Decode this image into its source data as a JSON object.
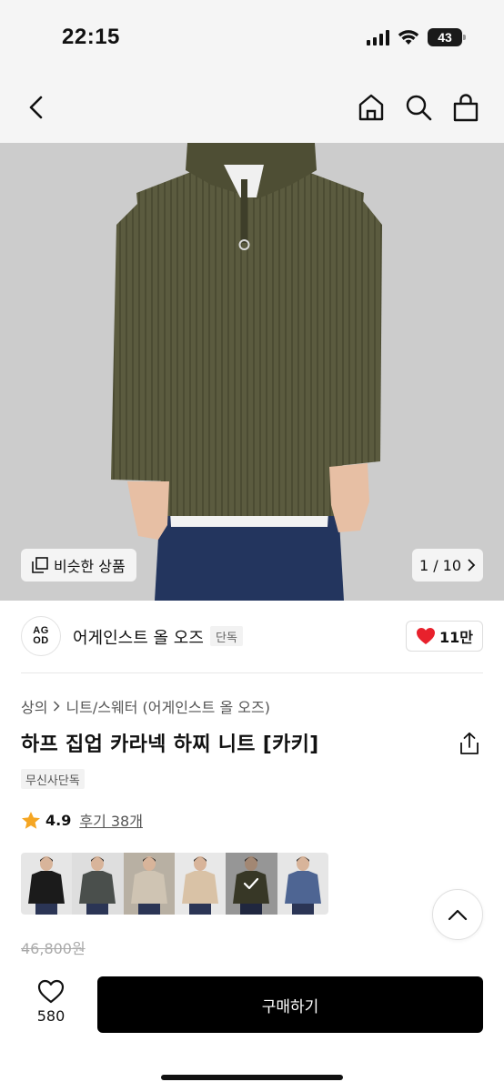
{
  "status_bar": {
    "time": "22:15",
    "battery": "43",
    "icons": [
      "signal-icon",
      "wifi-icon",
      "battery-icon"
    ]
  },
  "nav": {
    "icons": [
      "back-chevron-icon",
      "home-icon",
      "search-icon",
      "shopping-bag-icon"
    ]
  },
  "hero": {
    "similar_label": "비슷한 상품",
    "similar_icon": "similar-products-icon",
    "counter": "1 / 10",
    "next_icon": "chevron-right-icon"
  },
  "brand": {
    "logo_top": "AG",
    "logo_bottom": "OD",
    "name": "어게인스트 올 오즈",
    "badge": "단독",
    "likes": "11만",
    "like_color": "#e8212c"
  },
  "product": {
    "breadcrumb": [
      "상의",
      "니트/스웨터 (어게인스트 올 오즈)"
    ],
    "title": "하프 집업 카라넥 하찌 니트 [카키]",
    "tag": "무신사단독",
    "rating": "4.9",
    "reviews": "후기 38개",
    "star_color": "#f5a623",
    "original_price": "46,800원"
  },
  "color_options": [
    {
      "color": "#1b1b1b",
      "bg": "#e6e6e6"
    },
    {
      "color": "#4a4f4c",
      "bg": "#dedede"
    },
    {
      "color": "#cfc4b3",
      "bg": "#b8b0a3"
    },
    {
      "color": "#d9c2a6",
      "bg": "#e8e8e8"
    },
    {
      "color": "#4a4a33",
      "bg": "#c8c8c8",
      "selected": true
    },
    {
      "color": "#4e6593",
      "bg": "#e6e6e6"
    }
  ],
  "bottom_bar": {
    "wish_count": "580",
    "buy_label": "구매하기"
  }
}
